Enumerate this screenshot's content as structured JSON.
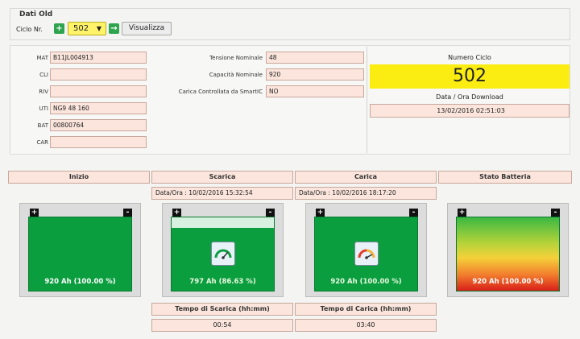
{
  "header": {
    "legend": "Dati Old",
    "ciclo_label": "Ciclo Nr.",
    "prev_icon": "+",
    "next_icon": "→",
    "selected_cycle": "502",
    "dropdown_arrow": "▼",
    "view_button": "Visualizza"
  },
  "fields_left": [
    {
      "label": "MAT",
      "value": "B11JL004913"
    },
    {
      "label": "CLI",
      "value": ""
    },
    {
      "label": "RIV",
      "value": ""
    },
    {
      "label": "UTI",
      "value": "NG9 48 160"
    },
    {
      "label": "BAT",
      "value": "00800764"
    },
    {
      "label": "CAR",
      "value": ""
    }
  ],
  "fields_mid": [
    {
      "label": "Tensione Nominale",
      "value": "48"
    },
    {
      "label": "Capacità Nominale",
      "value": "920"
    },
    {
      "label": "Carica Controllata da SmartIC",
      "value": "NO"
    }
  ],
  "cycle": {
    "title": "Numero Ciclo",
    "number": "502",
    "download_title": "Data / Ora Download",
    "download_value": "13/02/2016 02:51:03"
  },
  "sections": {
    "inizio": "Inizio",
    "scarica": "Scarica",
    "carica": "Carica",
    "stato": "Stato Batteria"
  },
  "dates": {
    "scarica": "Data/Ora : 10/02/2016 15:32:54",
    "carica": "Data/Ora : 10/02/2016 18:17:20"
  },
  "batteries": {
    "plus": "+",
    "minus": "-",
    "inizio": "920 Ah (100.00 %)",
    "scarica": "797 Ah (86.63 %)",
    "carica": "920 Ah (100.00 %)",
    "stato": "920 Ah (100.00 %)"
  },
  "tempo": {
    "scarica_label": "Tempo di Scarica (hh:mm)",
    "scarica_value": "00:54",
    "carica_label": "Tempo di Carica (hh:mm)",
    "carica_value": "03:40"
  },
  "colors": {
    "battery_green": "#0b9e3e",
    "field_bg": "#fbe5dc",
    "cycle_highlight": "#fbed12"
  },
  "icons": [
    "gauge-icon",
    "battery-icon",
    "plus-terminal-icon",
    "minus-terminal-icon"
  ]
}
